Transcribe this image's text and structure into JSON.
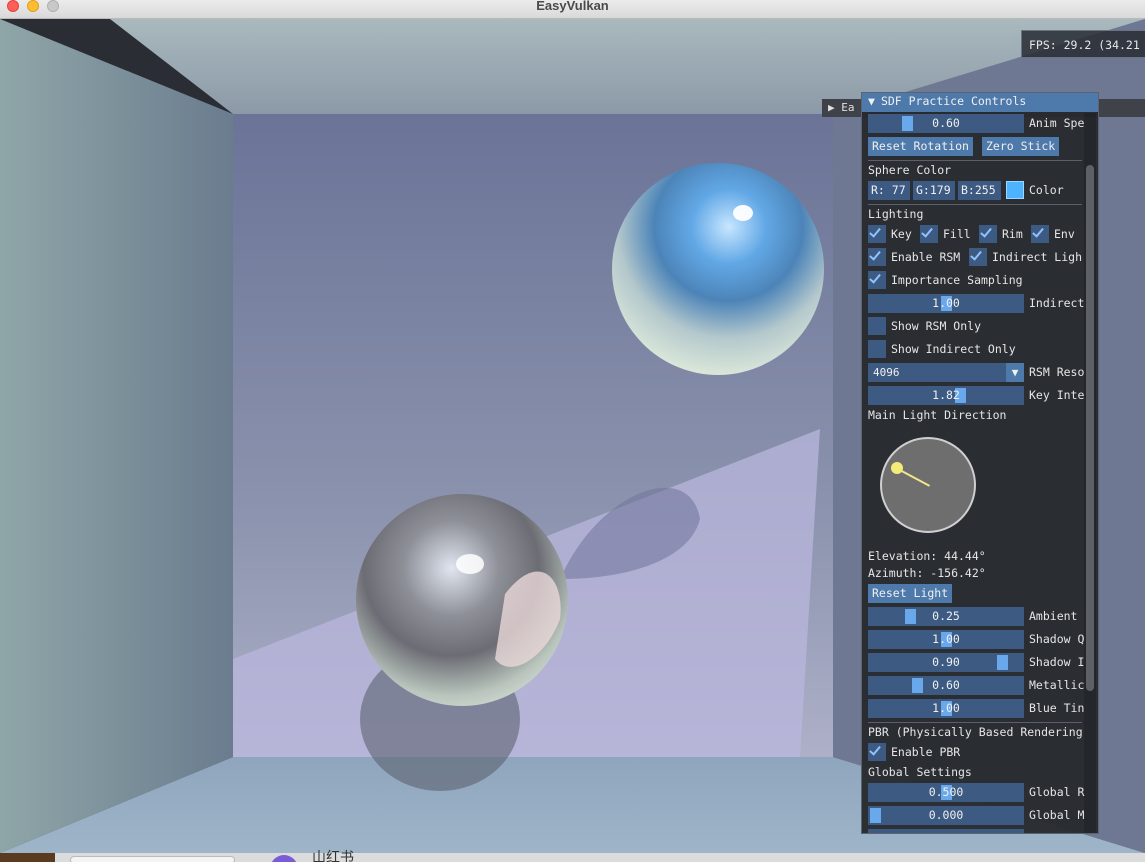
{
  "window": {
    "title": "EasyVulkan"
  },
  "overlay": {
    "fps_text": "FPS: 29.2 (34.21"
  },
  "collapsed_window": {
    "label": "Ea"
  },
  "panel": {
    "title": "SDF Practice Controls",
    "anim_speed": {
      "value": "0.60",
      "label": "Anim Spe",
      "fraction": 0.23
    },
    "buttons": {
      "reset_rotation": "Reset Rotation",
      "zero_stick": "Zero Stick"
    },
    "sphere_color": {
      "heading": "Sphere Color",
      "r": "R: 77",
      "g": "G:179",
      "b": "B:255",
      "label": "Color",
      "swatch": "#4db3ff"
    },
    "lighting": {
      "heading": "Lighting",
      "key": "Key",
      "fill": "Fill",
      "rim": "Rim",
      "env": "Env",
      "enable_rsm": "Enable RSM",
      "indirect_light": "Indirect Ligh",
      "importance_sampling": "Importance Sampling",
      "indirect_slider": {
        "value": "1.00",
        "label": "Indirect",
        "fraction": 0.5
      },
      "show_rsm_only": "Show RSM Only",
      "show_indirect_only": "Show Indirect Only",
      "rsm_res": {
        "value": "4096",
        "label": "RSM Reso"
      },
      "key_intensity": {
        "value": "1.82",
        "label": "Key Inte",
        "fraction": 0.6
      },
      "main_light_heading": "Main Light Direction",
      "elevation": "Elevation: 44.44°",
      "azimuth": "Azimuth: -156.42°",
      "reset_light": "Reset Light",
      "ambient": {
        "value": "0.25",
        "label": "Ambient",
        "fraction": 0.25
      },
      "shadow_q": {
        "value": "1.00",
        "label": "Shadow Q",
        "fraction": 0.5
      },
      "shadow_i": {
        "value": "0.90",
        "label": "Shadow I",
        "fraction": 0.9
      },
      "metallic": {
        "value": "0.60",
        "label": "Metallic",
        "fraction": 0.3
      },
      "blue_tint": {
        "value": "1.00",
        "label": "Blue Tin",
        "fraction": 0.5
      }
    },
    "pbr": {
      "heading": "PBR (Physically Based Rendering",
      "enable_pbr": "Enable PBR",
      "global_heading": "Global Settings",
      "global_r": {
        "value": "0.500",
        "label": "Global R",
        "fraction": 0.5
      },
      "global_m": {
        "value": "0.000",
        "label": "Global M",
        "fraction": 0.0
      }
    }
  },
  "dock": {
    "text": "山红书"
  }
}
